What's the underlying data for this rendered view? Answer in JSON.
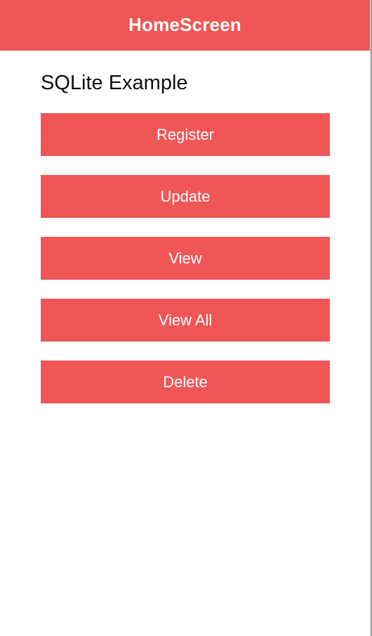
{
  "header": {
    "title": "HomeScreen"
  },
  "main": {
    "title": "SQLite Example",
    "buttons": [
      {
        "label": "Register"
      },
      {
        "label": "Update"
      },
      {
        "label": "View"
      },
      {
        "label": "View All"
      },
      {
        "label": "Delete"
      }
    ]
  },
  "colors": {
    "accent": "#f05656",
    "background": "#ffffff",
    "text": "#111111"
  }
}
